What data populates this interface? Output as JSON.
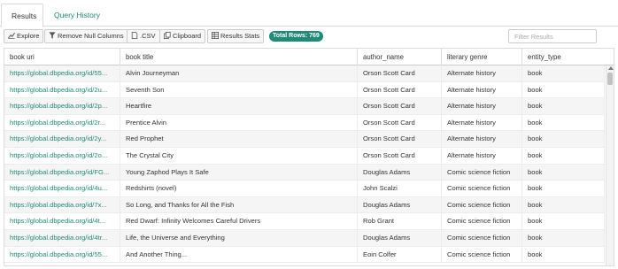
{
  "tabs": [
    {
      "label": "Results",
      "active": true
    },
    {
      "label": "Query History",
      "active": false
    }
  ],
  "toolbar": {
    "explore": "Explore",
    "remove_null": "Remove Null Columns",
    "csv": ".CSV",
    "clipboard": "Clipboard",
    "stats": "Results Stats",
    "total_rows": "Total Rows: 769"
  },
  "filter": {
    "placeholder": "Filter Results"
  },
  "colors": {
    "accent": "#1f8a78",
    "row_alt": "#f5f5f5"
  },
  "table": {
    "headers": [
      "book uri",
      "book title",
      "author_name",
      "literary genre",
      "entity_type"
    ],
    "rows": [
      [
        "https://global.dbpedia.org/id/55...",
        "Alvin Journeyman",
        "Orson Scott Card",
        "Alternate history",
        "book"
      ],
      [
        "https://global.dbpedia.org/id/2u...",
        "Seventh Son",
        "Orson Scott Card",
        "Alternate history",
        "book"
      ],
      [
        "https://global.dbpedia.org/id/2p...",
        "Heartfire",
        "Orson Scott Card",
        "Alternate history",
        "book"
      ],
      [
        "https://global.dbpedia.org/id/2r...",
        "Prentice Alvin",
        "Orson Scott Card",
        "Alternate history",
        "book"
      ],
      [
        "https://global.dbpedia.org/id/2y...",
        "Red Prophet",
        "Orson Scott Card",
        "Alternate history",
        "book"
      ],
      [
        "https://global.dbpedia.org/id/2o...",
        "The Crystal City",
        "Orson Scott Card",
        "Alternate history",
        "book"
      ],
      [
        "https://global.dbpedia.org/id/FG...",
        "Young Zaphod Plays It Safe",
        "Douglas Adams",
        "Comic science fiction",
        "book"
      ],
      [
        "https://global.dbpedia.org/id/4u...",
        "Redshirts (novel)",
        "John Scalzi",
        "Comic science fiction",
        "book"
      ],
      [
        "https://global.dbpedia.org/id/7x...",
        "So Long, and Thanks for All the Fish",
        "Douglas Adams",
        "Comic science fiction",
        "book"
      ],
      [
        "https://global.dbpedia.org/id/4t...",
        "Red Dwarf: Infinity Welcomes Careful Drivers",
        "Rob Grant",
        "Comic science fiction",
        "book"
      ],
      [
        "https://global.dbpedia.org/id/4tr...",
        "Life, the Universe and Everything",
        "Douglas Adams",
        "Comic science fiction",
        "book"
      ],
      [
        "https://global.dbpedia.org/id/55...",
        "And Another Thing...",
        "Eoin Colfer",
        "Comic science fiction",
        "book"
      ]
    ]
  }
}
